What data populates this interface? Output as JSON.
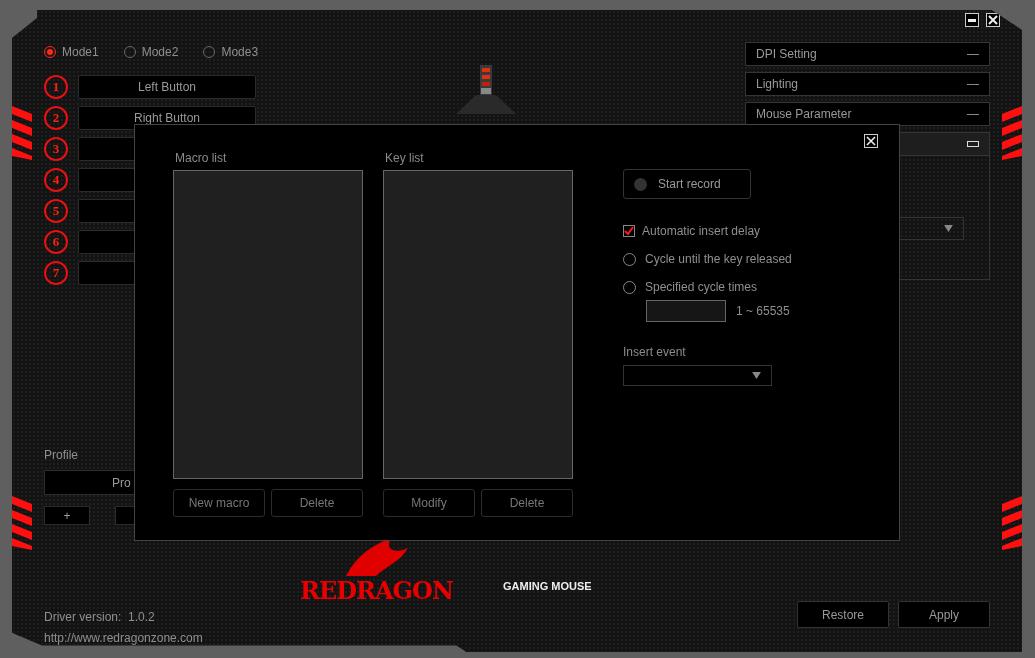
{
  "modes": [
    {
      "label": "Mode1",
      "selected": true
    },
    {
      "label": "Mode2",
      "selected": false
    },
    {
      "label": "Mode3",
      "selected": false
    }
  ],
  "buttons": [
    {
      "number": "1",
      "label": "Left Button"
    },
    {
      "number": "2",
      "label": "Right Button"
    },
    {
      "number": "3"
    },
    {
      "number": "4"
    },
    {
      "number": "5"
    },
    {
      "number": "6"
    },
    {
      "number": "7"
    }
  ],
  "profile": {
    "heading": "Profile",
    "current": "Pro",
    "add": "+"
  },
  "footer": {
    "driver_label": "Driver version:",
    "driver_version": "1.0.2",
    "url": "http://www.redragonzone.com"
  },
  "logo": {
    "brand": "REDRAGON",
    "tagline": "GAMING MOUSE"
  },
  "panels": [
    {
      "label": "DPI Setting",
      "expanded": false
    },
    {
      "label": "Lighting",
      "expanded": false
    },
    {
      "label": "Mouse Parameter",
      "expanded": false
    },
    {
      "expanded": true
    }
  ],
  "actions": [
    "Restore",
    "Apply"
  ],
  "dialog": {
    "macro_list_label": "Macro list",
    "key_list_label": "Key list",
    "macro_buttons": [
      "New macro",
      "Delete"
    ],
    "key_buttons": [
      "Modify",
      "Delete"
    ],
    "record_button": "Start record",
    "options": [
      {
        "kind": "checkbox",
        "label": "Automatic insert delay",
        "checked": true
      },
      {
        "kind": "radio",
        "label": "Cycle until the key released",
        "selected": false
      },
      {
        "kind": "radio",
        "label": "Specified cycle times",
        "selected": false
      }
    ],
    "cycle_range": "1 ~ 65535",
    "insert_event_label": "Insert event"
  }
}
